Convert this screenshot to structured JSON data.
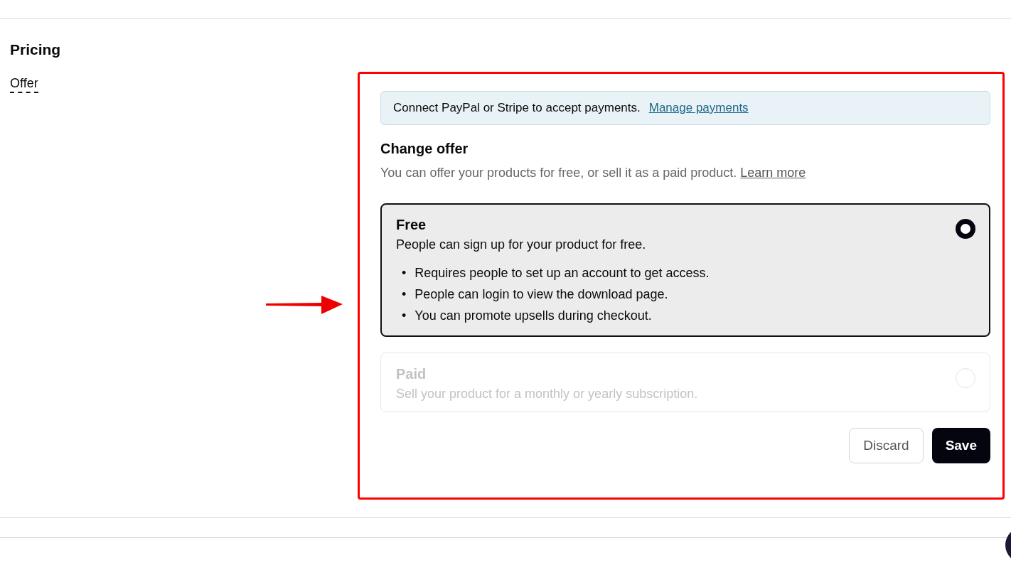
{
  "section": {
    "title": "Pricing",
    "field_label": "Offer"
  },
  "notice": {
    "text": "Connect PayPal or Stripe to accept payments.",
    "link": "Manage payments"
  },
  "offer": {
    "title": "Change offer",
    "description": "You can offer your products for free, or sell it as a paid product.",
    "link": "Learn more",
    "options": [
      {
        "title": "Free",
        "description": "People can sign up for your product for free.",
        "selected": true,
        "disabled": false,
        "bullets": [
          {
            "marker": "•",
            "text": "Requires people to set up an account to get access."
          },
          {
            "marker": "•",
            "text": "People can login to view the download page."
          },
          {
            "marker": "•",
            "text": "You can promote upsells during checkout."
          }
        ]
      },
      {
        "title": "Paid",
        "description": "Sell your product for a monthly or yearly subscription.",
        "selected": false,
        "disabled": true
      }
    ]
  },
  "buttons": {
    "discard": "Discard",
    "save": "Save"
  }
}
